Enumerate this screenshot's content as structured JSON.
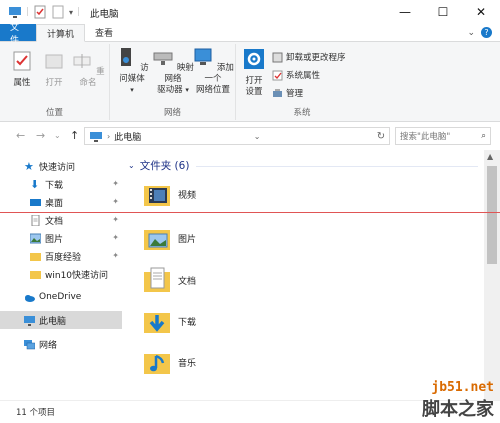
{
  "window": {
    "title": "此电脑",
    "minimize": "—",
    "maximize": "☐",
    "close": "✕"
  },
  "tabs": {
    "file": "文件",
    "computer": "计算机",
    "view": "查看"
  },
  "ribbon": {
    "location": {
      "label": "位置",
      "properties": "属性",
      "open": "打开",
      "rename": "重命名"
    },
    "network": {
      "label": "网络",
      "access_media": "访问媒体",
      "map_drive_1": "映射网络",
      "map_drive_2": "驱动器",
      "add_location_1": "添加一个",
      "add_location_2": "网络位置"
    },
    "system": {
      "label": "系统",
      "open_settings_1": "打开",
      "open_settings_2": "设置",
      "uninstall": "卸载或更改程序",
      "system_properties": "系统属性",
      "manage": "管理"
    }
  },
  "address": {
    "path": "此电脑",
    "search_placeholder": "搜索\"此电脑\""
  },
  "nav": {
    "quick_access": "快速访问",
    "items": [
      {
        "label": "下载"
      },
      {
        "label": "桌面"
      },
      {
        "label": "文档"
      },
      {
        "label": "图片"
      },
      {
        "label": "百度经验"
      },
      {
        "label": "win10快速访问"
      }
    ],
    "onedrive": "OneDrive",
    "this_pc": "此电脑",
    "network": "网络"
  },
  "main": {
    "section": "文件夹 (6)",
    "folders": [
      {
        "name": "视频"
      },
      {
        "name": "图片"
      },
      {
        "name": "文档"
      },
      {
        "name": "下载"
      },
      {
        "name": "音乐"
      }
    ]
  },
  "status": {
    "count": "11 个项目"
  },
  "watermark": {
    "url": "jb51.net",
    "text": "脚本之家"
  },
  "colors": {
    "accent": "#1979ca",
    "folder": "#f3c64a",
    "section_title": "#1e3287"
  }
}
